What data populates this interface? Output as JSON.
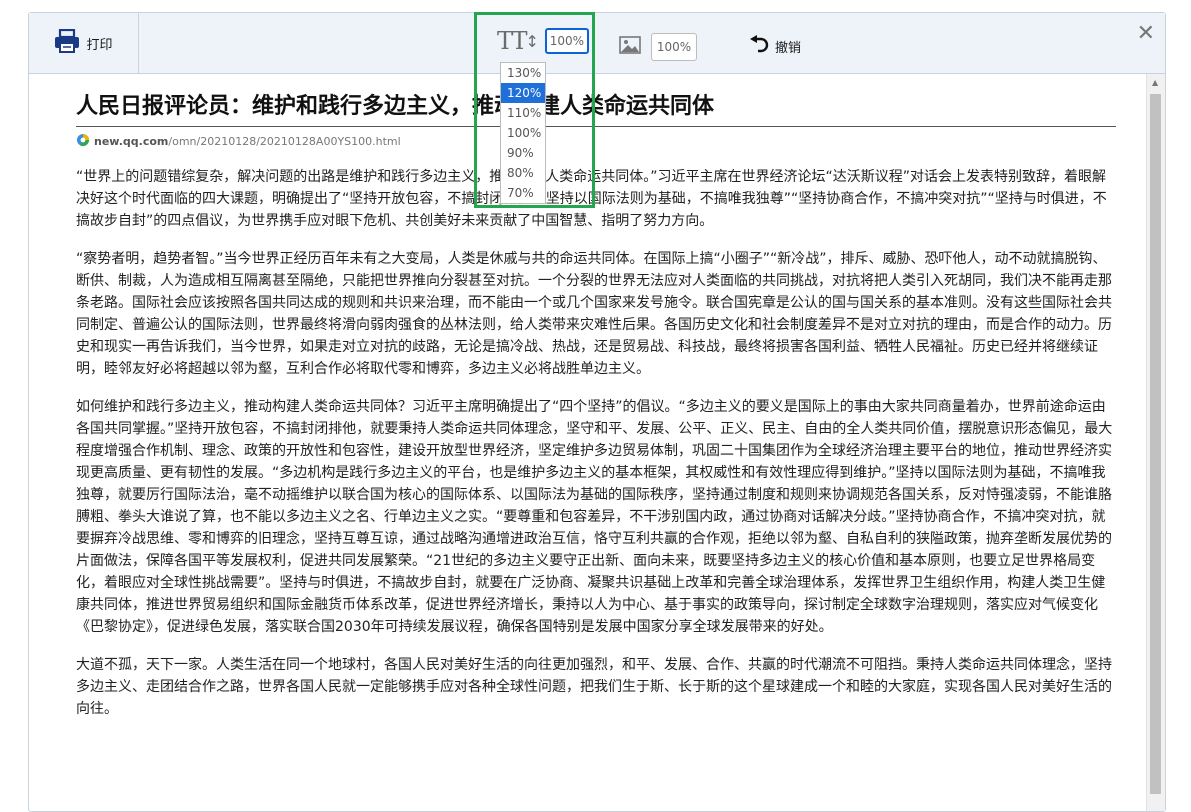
{
  "toolbar": {
    "print_label": "打印",
    "font_zoom": "100%",
    "image_zoom": "100%",
    "undo_label": "撤销",
    "close_glyph": "✕"
  },
  "zoom_dropdown": {
    "options": [
      "130%",
      "120%",
      "110%",
      "100%",
      "90%",
      "80%",
      "70%"
    ],
    "selected": "120%"
  },
  "article": {
    "title": "人民日报评论员：维护和践行多边主义，推动构建人类命运共同体",
    "source_domain": "new.qq.com",
    "source_path": "/omn/20210128/20210128A00YS100.html",
    "paragraphs": [
      "“世界上的问题错综复杂，解决问题的出路是维护和践行多边主义，推动构建人类命运共同体。”习近平主席在世界经济论坛“达沃斯议程”对话会上发表特别致辞，着眼解决好这个时代面临的四大课题，明确提出了“坚持开放包容，不搞封闭排他”“坚持以国际法则为基础，不搞唯我独尊”“坚持协商合作，不搞冲突对抗”“坚持与时俱进，不搞故步自封”的四点倡议，为世界携手应对眼下危机、共创美好未来贡献了中国智慧、指明了努力方向。",
      "“察势者明，趋势者智。”当今世界正经历百年未有之大变局，人类是休戚与共的命运共同体。在国际上搞“小圈子”“新冷战”，排斥、威胁、恐吓他人，动不动就搞脱钩、断供、制裁，人为造成相互隔离甚至隔绝，只能把世界推向分裂甚至对抗。一个分裂的世界无法应对人类面临的共同挑战，对抗将把人类引入死胡同，我们决不能再走那条老路。国际社会应该按照各国共同达成的规则和共识来治理，而不能由一个或几个国家来发号施令。联合国宪章是公认的国与国关系的基本准则。没有这些国际社会共同制定、普遍公认的国际法则，世界最终将滑向弱肉强食的丛林法则，给人类带来灾难性后果。各国历史文化和社会制度差异不是对立对抗的理由，而是合作的动力。历史和现实一再告诉我们，当今世界，如果走对立对抗的歧路，无论是搞冷战、热战，还是贸易战、科技战，最终将损害各国利益、牺牲人民福祉。历史已经并将继续证明，睦邻友好必将超越以邻为壑，互利合作必将取代零和博弈，多边主义必将战胜单边主义。",
      "如何维护和践行多边主义，推动构建人类命运共同体？习近平主席明确提出了“四个坚持”的倡议。“多边主义的要义是国际上的事由大家共同商量着办，世界前途命运由各国共同掌握。”坚持开放包容，不搞封闭排他，就要秉持人类命运共同体理念，坚守和平、发展、公平、正义、民主、自由的全人类共同价值，摆脱意识形态偏见，最大程度增强合作机制、理念、政策的开放性和包容性，建设开放型世界经济，坚定维护多边贸易体制，巩固二十国集团作为全球经济治理主要平台的地位，推动世界经济实现更高质量、更有韧性的发展。“多边机构是践行多边主义的平台，也是维护多边主义的基本框架，其权威性和有效性理应得到维护。”坚持以国际法则为基础，不搞唯我独尊，就要厉行国际法治，毫不动摇维护以联合国为核心的国际体系、以国际法为基础的国际秩序，坚持通过制度和规则来协调规范各国关系，反对恃强凌弱，不能谁胳膊粗、拳头大谁说了算，也不能以多边主义之名、行单边主义之实。“要尊重和包容差异，不干涉别国内政，通过协商对话解决分歧。”坚持协商合作，不搞冲突对抗，就要摒弃冷战思维、零和博弈的旧理念，坚持互尊互谅，通过战略沟通增进政治互信，恪守互利共赢的合作观，拒绝以邻为壑、自私自利的狭隘政策，抛弃垄断发展优势的片面做法，保障各国平等发展权利，促进共同发展繁荣。“21世纪的多边主义要守正出新、面向未来，既要坚持多边主义的核心价值和基本原则，也要立足世界格局变化，着眼应对全球性挑战需要”。坚持与时俱进，不搞故步自封，就要在广泛协商、凝聚共识基础上改革和完善全球治理体系，发挥世界卫生组织作用，构建人类卫生健康共同体，推进世界贸易组织和国际金融货币体系改革，促进世界经济增长，秉持以人为中心、基于事实的政策导向，探讨制定全球数字治理规则，落实应对气候变化《巴黎协定》，促进绿色发展，落实联合国2030年可持续发展议程，确保各国特别是发展中国家分享全球发展带来的好处。",
      "大道不孤，天下一家。人类生活在同一个地球村，各国人民对美好生活的向往更加强烈，和平、发展、合作、共赢的时代潮流不可阻挡。秉持人类命运共同体理念，坚持多边主义、走团结合作之路，世界各国人民就一定能够携手应对各种全球性问题，把我们生于斯、长于斯的这个星球建成一个和睦的大家庭，实现各国人民对美好生活的向往。"
    ]
  },
  "colors": {
    "toolbar_bg": "#eef3f9",
    "print_icon": "#1a3a86",
    "dropdown_selected": "#1f6fd9",
    "highlight_box": "#25a54d"
  }
}
